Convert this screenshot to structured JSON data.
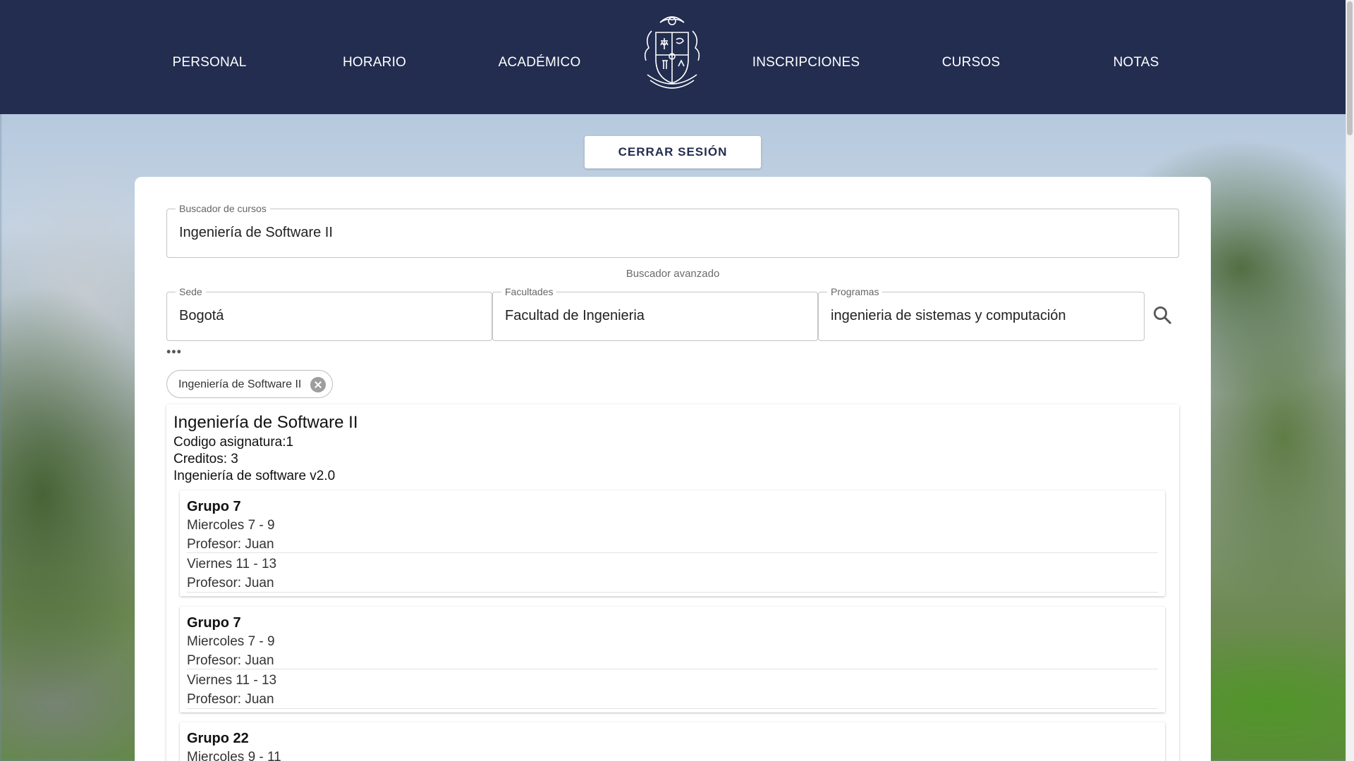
{
  "nav": {
    "items": [
      "PERSONAL",
      "HORARIO",
      "ACADÉMICO",
      "INSCRIPCIONES",
      "CURSOS",
      "NOTAS"
    ],
    "logo_icon": "university-crest-icon"
  },
  "logout_label": "CERRAR SESIÓN",
  "search": {
    "legend": "Buscador de cursos",
    "value": "Ingeniería de Software II",
    "advanced_label": "Buscador avanzado",
    "sede": {
      "legend": "Sede",
      "value": "Bogotá"
    },
    "facultades": {
      "legend": "Facultades",
      "value": "Facultad de Ingenieria"
    },
    "programas": {
      "legend": "Programas",
      "value": "ingenieria de sistemas y computación"
    },
    "more": "•••"
  },
  "chip": {
    "label": "Ingeniería de Software II"
  },
  "course": {
    "title": "Ingeniería de Software II",
    "codigo": "Codigo asignatura:1",
    "creditos": "Creditos: 3",
    "descripcion": "Ingeniería de software v2.0",
    "groups": [
      {
        "title": "Grupo 7",
        "lines": [
          "Miercoles 7 - 9",
          "Profesor: Juan",
          "Viernes 11 - 13",
          "Profesor: Juan"
        ]
      },
      {
        "title": "Grupo 7",
        "lines": [
          "Miercoles 7 - 9",
          "Profesor: Juan",
          "Viernes 11 - 13",
          "Profesor: Juan"
        ]
      },
      {
        "title": "Grupo 22",
        "lines": [
          "Miercoles 9 - 11"
        ]
      }
    ]
  },
  "colors": {
    "header": "#222d4f",
    "card": "#ffffff"
  }
}
